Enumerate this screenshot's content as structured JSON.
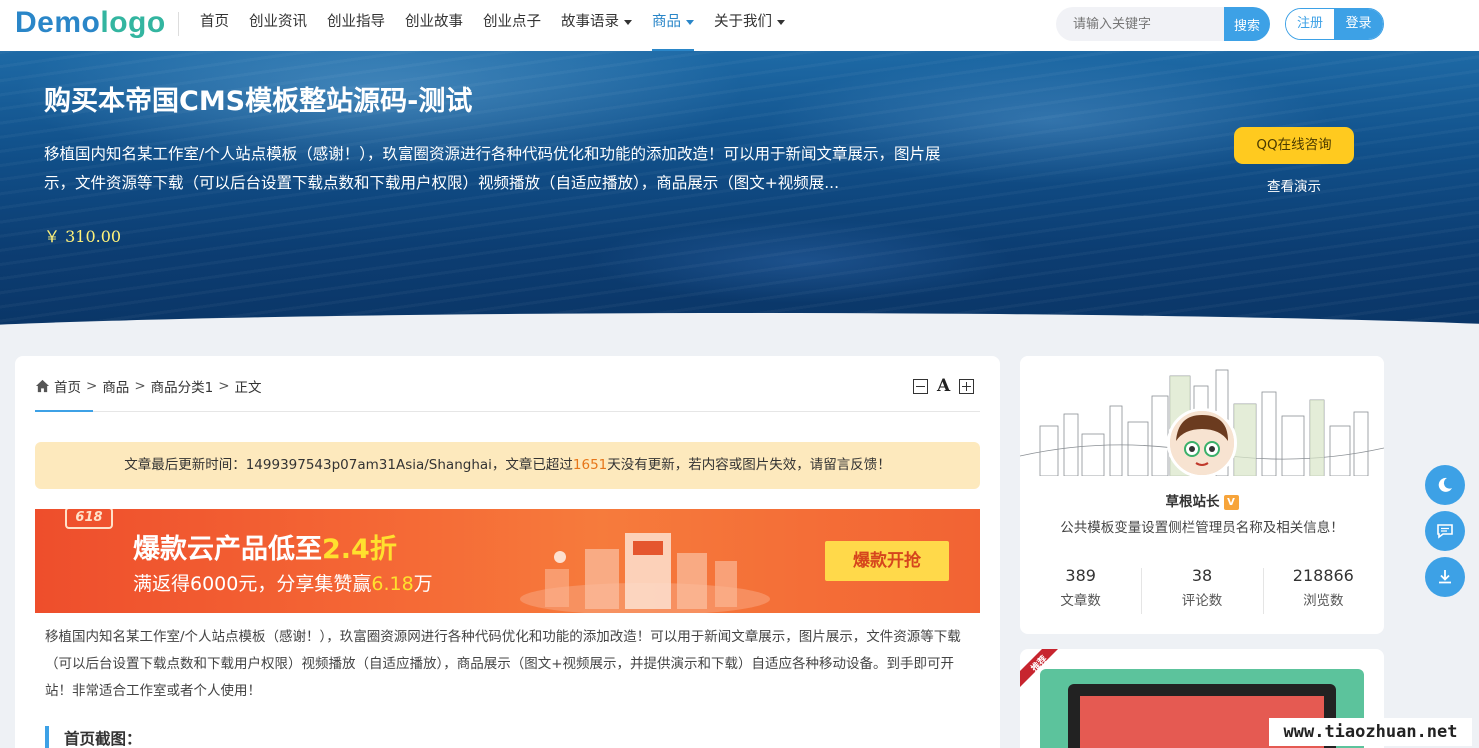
{
  "header": {
    "logo_part1": "Demo",
    "logo_part2": "logo",
    "nav": [
      {
        "label": "首页"
      },
      {
        "label": "创业资讯"
      },
      {
        "label": "创业指导"
      },
      {
        "label": "创业故事"
      },
      {
        "label": "创业点子"
      },
      {
        "label": "故事语录"
      },
      {
        "label": "商品"
      },
      {
        "label": "关于我们"
      }
    ],
    "active_nav": "商品",
    "search_placeholder": "请输入关键字",
    "search_button": "搜索",
    "register_label": "注册",
    "login_label": "登录"
  },
  "hero": {
    "title": "购买本帝国CMS模板整站源码-测试",
    "description": "移植国内知名某工作室/个人站点模板（感谢！），玖富圈资源进行各种代码优化和功能的添加改造！可以用于新闻文章展示，图片展示，文件资源等下载（可以后台设置下载点数和下载用户权限）视频播放（自适应播放），商品展示（图文+视频展...",
    "price": "￥ 310.00",
    "qq_button": "QQ在线咨询",
    "demo_link": "查看演示"
  },
  "breadcrumb": {
    "items": [
      "首页",
      "商品",
      "商品分类1",
      "正文"
    ],
    "separator": ">"
  },
  "notice": {
    "prefix": "文章最后更新时间：1499397543p07am31Asia/Shanghai，文章已超过",
    "days": "1651",
    "suffix": "天没有更新，若内容或图片失效，请留言反馈！"
  },
  "ad_banner": {
    "tag": "618",
    "line1_prefix": "爆款云产品低至",
    "line1_highlight": "2.4折",
    "line2_prefix": "满返得6000元，分享集赞赢",
    "line2_highlight": "6.18",
    "line2_suffix": "万",
    "button": "爆款开抢"
  },
  "article": {
    "body": "移植国内知名某工作室/个人站点模板（感谢！），玖富圈资源网进行各种代码优化和功能的添加改造！可以用于新闻文章展示，图片展示，文件资源等下载（可以后台设置下载点数和下载用户权限）视频播放（自适应播放），商品展示（图文+视频展示，并提供演示和下载）自适应各种移动设备。到手即可开站！非常适合工作室或者个人使用！",
    "section_heading": "首页截图："
  },
  "sidebar": {
    "admin_name": "草根站长",
    "badge": "V",
    "admin_desc": "公共模板变量设置侧栏管理员名称及相关信息！",
    "stats": [
      {
        "value": "389",
        "label": "文章数"
      },
      {
        "value": "38",
        "label": "评论数"
      },
      {
        "value": "218866",
        "label": "浏览数"
      }
    ],
    "ribbon": "推荐"
  },
  "watermark": "www.tiaozhuan.net",
  "colors": {
    "accent": "#3da1e6",
    "notice_bg": "#fde9bd",
    "qq_button": "#ffca1f",
    "price": "#fff27a"
  }
}
